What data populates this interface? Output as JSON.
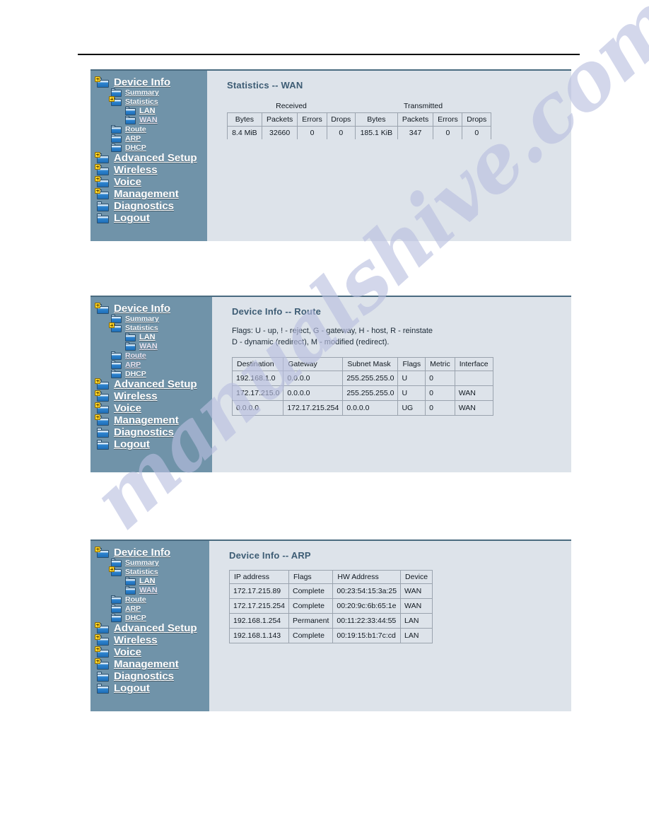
{
  "nav": {
    "items": [
      {
        "label": "Device Info",
        "level": 0,
        "icon": "folder-plus-icon",
        "visited": false
      },
      {
        "label": "Summary",
        "level": 1,
        "icon": "folder-icon",
        "visited": false
      },
      {
        "label": "Statistics",
        "level": 1,
        "icon": "folder-plus-icon",
        "visited": false
      },
      {
        "label": "LAN",
        "level": 2,
        "icon": "folder-icon",
        "visited": false
      },
      {
        "label": "WAN",
        "level": 2,
        "icon": "folder-icon",
        "visited": true
      },
      {
        "label": "Route",
        "level": 1,
        "icon": "folder-icon",
        "visited": false
      },
      {
        "label": "ARP",
        "level": 1,
        "icon": "folder-icon",
        "visited": false
      },
      {
        "label": "DHCP",
        "level": 1,
        "icon": "folder-icon",
        "visited": false
      },
      {
        "label": "Advanced Setup",
        "level": 0,
        "icon": "folder-plus-icon",
        "visited": false
      },
      {
        "label": "Wireless",
        "level": 0,
        "icon": "folder-plus-icon",
        "visited": false
      },
      {
        "label": "Voice",
        "level": 0,
        "icon": "folder-plus-icon",
        "visited": false
      },
      {
        "label": "Management",
        "level": 0,
        "icon": "folder-plus-icon",
        "visited": false
      },
      {
        "label": "Diagnostics",
        "level": 0,
        "icon": "folder-icon",
        "visited": false
      },
      {
        "label": "Logout",
        "level": 0,
        "icon": "folder-icon",
        "visited": false
      }
    ],
    "nav2_visited": [
      "Route",
      "ARP"
    ],
    "nav3_visited": [
      "WAN"
    ]
  },
  "panel1": {
    "title": "Statistics -- WAN",
    "table": {
      "group_headers": [
        "",
        "Received",
        "Transmitted"
      ],
      "columns": [
        "Bytes",
        "Packets",
        "Errors",
        "Drops",
        "Bytes",
        "Packets",
        "Errors",
        "Drops"
      ],
      "rows": [
        [
          "8.4 MiB",
          "32660",
          "0",
          "0",
          "185.1 KiB",
          "347",
          "0",
          "0"
        ]
      ]
    }
  },
  "panel2": {
    "title": "Device Info -- Route",
    "flags_line1": "Flags: U - up, ! - reject, G - gateway, H - host, R - reinstate",
    "flags_line2": "D - dynamic (redirect), M - modified (redirect).",
    "table": {
      "columns": [
        "Destination",
        "Gateway",
        "Subnet Mask",
        "Flags",
        "Metric",
        "Interface"
      ],
      "rows": [
        [
          "192.168.1.0",
          "0.0.0.0",
          "255.255.255.0",
          "U",
          "0",
          ""
        ],
        [
          "172.17.215.0",
          "0.0.0.0",
          "255.255.255.0",
          "U",
          "0",
          "WAN"
        ],
        [
          "0.0.0.0",
          "172.17.215.254",
          "0.0.0.0",
          "UG",
          "0",
          "WAN"
        ]
      ]
    }
  },
  "panel3": {
    "title": "Device Info -- ARP",
    "table": {
      "columns": [
        "IP address",
        "Flags",
        "HW Address",
        "Device"
      ],
      "rows": [
        [
          "172.17.215.89",
          "Complete",
          "00:23:54:15:3a:25",
          "WAN"
        ],
        [
          "172.17.215.254",
          "Complete",
          "00:20:9c:6b:65:1e",
          "WAN"
        ],
        [
          "192.168.1.254",
          "Permanent",
          "00:11:22:33:44:55",
          "LAN"
        ],
        [
          "192.168.1.143",
          "Complete",
          "00:19:15:b1:7c:cd",
          "LAN"
        ]
      ]
    }
  },
  "watermark": {
    "text": "manualshive.com"
  },
  "colors": {
    "sidebar_bg": "#7093a9",
    "content_bg": "#dde3ea",
    "panel_border_top": "#4a6b80",
    "title_text": "#3d5c74",
    "folder_blue": "#2f86d2",
    "badge_yellow": "#ffd42a",
    "watermark": "#b9bfe0"
  }
}
